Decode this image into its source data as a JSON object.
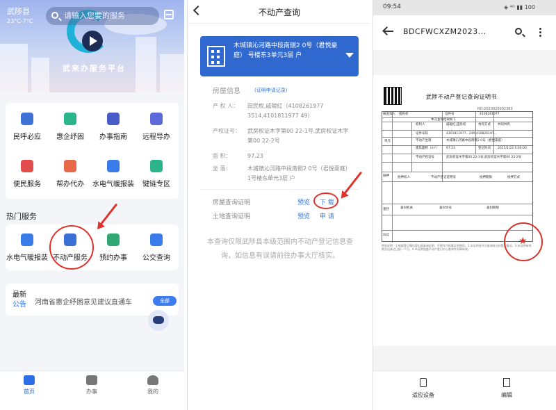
{
  "panel1": {
    "location": "武陟县",
    "temperature": "23°C-7°C",
    "search_placeholder": "请输入您要的服务",
    "brand": "武来办服务平台",
    "services_row1": [
      {
        "label": "民呼必应",
        "color": "#3f72d6"
      },
      {
        "label": "惠企纾困",
        "color": "#2ab58a"
      },
      {
        "label": "办事指南",
        "color": "#4a5ac9"
      },
      {
        "label": "远程导办",
        "color": "#5b6ad8"
      }
    ],
    "services_row2": [
      {
        "label": "便民服务",
        "color": "#e14d4d"
      },
      {
        "label": "帮办代办",
        "color": "#e86a4a"
      },
      {
        "label": "水电气暖报装",
        "color": "#3a7bea"
      },
      {
        "label": "键链专区",
        "color": "#2bb38a"
      }
    ],
    "hot_title": "热门服务",
    "hot_services": [
      {
        "label": "水电气暖报装",
        "color": "#3a7bea"
      },
      {
        "label": "不动产服务",
        "color": "#3a6fd8"
      },
      {
        "label": "预约办事",
        "color": "#30a874"
      },
      {
        "label": "公交查询",
        "color": "#3a7bea"
      }
    ],
    "notice": {
      "tag1": "最新",
      "tag2": "公告",
      "text": "河南省惠企纾困意见建议直通车",
      "button": "全部"
    },
    "tabs": [
      {
        "label": "首页"
      },
      {
        "label": "办事"
      },
      {
        "label": "我的"
      }
    ]
  },
  "panel2": {
    "title": "不动产查询",
    "address": "木城镇沁河路中段南侧2 0号（君悦豪庭） 号楼东3单元3层 户",
    "section": "房屋信息",
    "section_link": "(证明申请记录)",
    "fields": [
      {
        "label": "产 权 人：",
        "value": "田民权,戚聪红（4108261977 3514,4101811977 49）"
      },
      {
        "label": "产权证号：",
        "value": "武房权证木字第00 22-1号,武房权证木字第00 22-2号"
      },
      {
        "label": "面 积：",
        "value": "97.23"
      },
      {
        "label": "坐 落：",
        "value": "木城镇沁河路中段南侧2 0号（君悦豪庭） 1号楼东单元3层 户"
      }
    ],
    "cert_rows": [
      {
        "label": "房屋查询证明",
        "preview": "预览",
        "action": "下 载"
      },
      {
        "label": "土地查询证明",
        "preview": "预览",
        "action": "申 请"
      }
    ],
    "footnote": "本查询仅限武陟县本级范围内不动产登记信息查询，如信息有误请前往办事大厅核实。"
  },
  "panel3": {
    "time": "09:54",
    "signal": "◈ ⁴ᴳ ▮▮ 100",
    "doc_title_bar": "BDCFWCXZM2023...",
    "doc_title": "武陟不动产登记查询证明书",
    "doc_number": "NO:2023020002363",
    "table_cells": [
      {
        "text": "被查询人"
      },
      {
        "text": "田民权"
      },
      {
        "text": "证件号"
      },
      {
        "text": "4108261977"
      },
      {
        "text": "本次查询结果如下"
      },
      {
        "text": "权利人"
      },
      {
        "text": "戚聪红,田民权"
      },
      {
        "text": "共有方式"
      },
      {
        "text": "共同共有"
      },
      {
        "text": "证件号码"
      },
      {
        "text": "4101811977...249,410826197..."
      },
      {
        "text": "不动产坐落"
      },
      {
        "text": "木城镇沁河路中段南侧2 0号（君悦豪庭）"
      },
      {
        "text": "建筑面积（m²）"
      },
      {
        "text": "97.23"
      },
      {
        "text": "登记时间"
      },
      {
        "text": "2015/1/22 0:00:00"
      },
      {
        "text": "不动产权证号"
      },
      {
        "text": "武房权证木字第00 22-1号,武房权证木字第00 22-2号"
      },
      {
        "text": "单元"
      },
      {
        "text": "抵押"
      },
      {
        "text": "抵押权人"
      },
      {
        "text": "不动产登记证明号"
      },
      {
        "text": "抵押期限"
      },
      {
        "text": "抵押方式"
      },
      {
        "text": "查封"
      },
      {
        "text": "查封机关"
      },
      {
        "text": "查封文号"
      },
      {
        "text": "查封期限"
      },
      {
        "text": "异议"
      }
    ],
    "notes": "特别说明：1.根据登记簿内容出具查询证明，不得作为权属证明使用。2.本证明仅作为查询时点的登记情况。3.本证明有效期为出具之日起一个月。4.本证明加盖不动产登记中心查询专用章有效。",
    "seal_text": "武陟县不动产登记中心",
    "bottom_buttons": [
      {
        "label": "适应设备"
      },
      {
        "label": "编辑"
      }
    ]
  }
}
